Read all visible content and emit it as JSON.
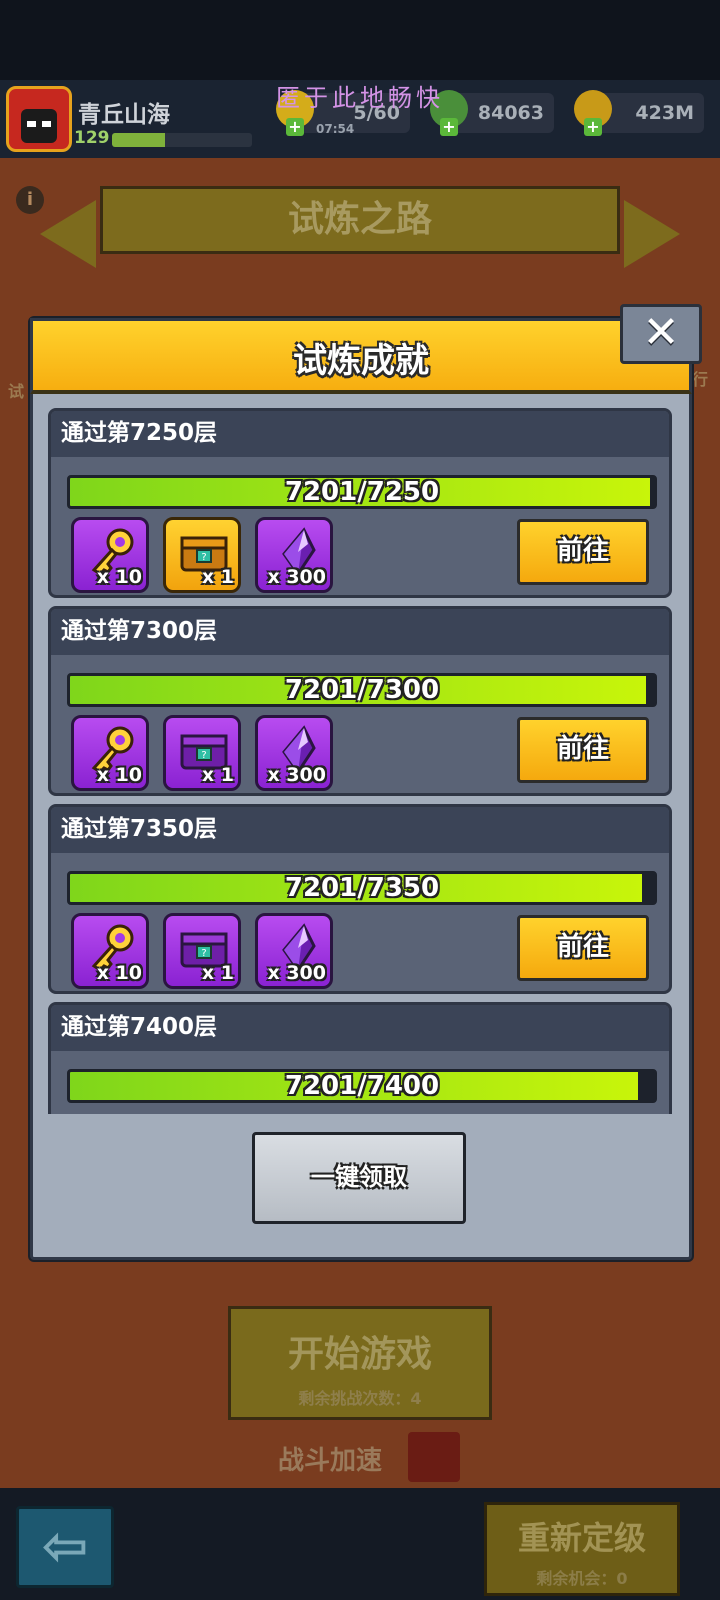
{
  "watermark": "匿于此地畅快",
  "player": {
    "name": "青丘山海",
    "level": "129",
    "xp_fraction": 0.38
  },
  "resources": {
    "stamina": "5/60",
    "stamina_timer": "07:54",
    "gems": "84063",
    "gold": "423M"
  },
  "background": {
    "title": "试炼之路",
    "info_icon": "i",
    "side_left": "试",
    "side_right": "行",
    "start_button": "开始游戏",
    "challenges_left": "剩余挑战次数：4",
    "speed_label": "战斗加速",
    "relevel_button": "重新定级",
    "relevel_chances": "剩余机会：0"
  },
  "modal": {
    "title": "试炼成就",
    "close": "✕",
    "claim_all": "一键领取",
    "cards": [
      {
        "title": "通过第7250层",
        "progress": "7201/7250",
        "fraction": 0.993,
        "rewards": [
          {
            "icon": "key-icon",
            "count": "x 10"
          },
          {
            "icon": "gold-chest-icon",
            "count": "x 1"
          },
          {
            "icon": "crystal-icon",
            "count": "x 300"
          }
        ],
        "action": "前往"
      },
      {
        "title": "通过第7300层",
        "progress": "7201/7300",
        "fraction": 0.986,
        "rewards": [
          {
            "icon": "key-icon",
            "count": "x 10"
          },
          {
            "icon": "purple-chest-icon",
            "count": "x 1"
          },
          {
            "icon": "crystal-icon",
            "count": "x 300"
          }
        ],
        "action": "前往"
      },
      {
        "title": "通过第7350层",
        "progress": "7201/7350",
        "fraction": 0.98,
        "rewards": [
          {
            "icon": "key-icon",
            "count": "x 10"
          },
          {
            "icon": "purple-chest-icon",
            "count": "x 1"
          },
          {
            "icon": "crystal-icon",
            "count": "x 300"
          }
        ],
        "action": "前往"
      },
      {
        "title": "通过第7400层",
        "progress": "7201/7400",
        "fraction": 0.973
      }
    ]
  },
  "colors": {
    "accent_yellow": "#f7ae10",
    "progress_green": "#a8ea12",
    "reward_purple": "#a23ae6"
  }
}
